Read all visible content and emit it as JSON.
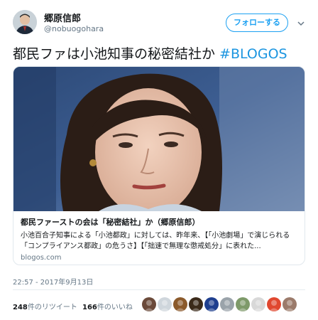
{
  "author": {
    "name": "郷原信郎",
    "handle": "@nobuogohara",
    "follow_label": "フォローする"
  },
  "tweet": {
    "text": "都民ファは小池知事の秘密結社か ",
    "hashtag": "#BLOGOS"
  },
  "card": {
    "title": "都民ファーストの会は「秘密結社」か（郷原信郎）",
    "description": "小池百合子知事による「小池都政」に対しては、昨年来、【「小池劇場」で演じられる「コンプライアンス都政」の危うさ】【「拙速で無理な懲戒処分」に表れた...",
    "domain": "blogos.com"
  },
  "timestamp": "22:57 - 2017年9月13日",
  "stats": {
    "retweets_count": "248",
    "retweets_label": "件のリツイート",
    "likes_count": "166",
    "likes_label": "件のいいね"
  },
  "liker_avatar_colors": [
    "#6b4a3a",
    "#cfd6dc",
    "#8b5a2b",
    "#3b2a1a",
    "#1f3f8f",
    "#9aa3aa",
    "#7e9a6a",
    "#d8d8d8",
    "#e0472f",
    "#9b7b6b"
  ]
}
